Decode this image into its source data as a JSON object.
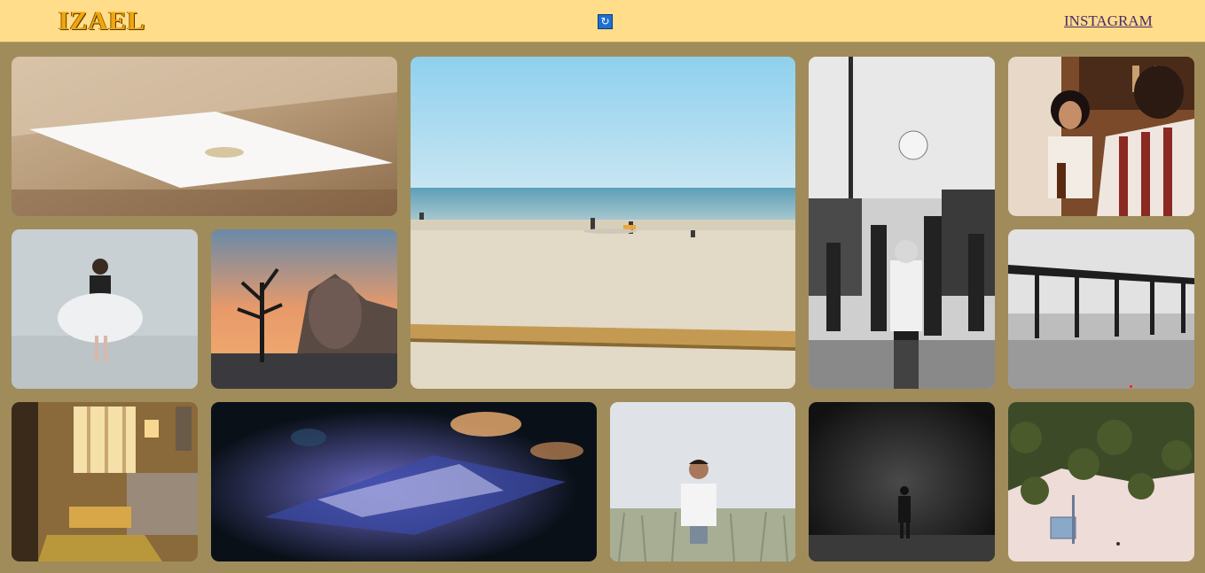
{
  "header": {
    "logo": "IZAEL",
    "center_icon": "photo-app-icon",
    "instagram_link": "INSTAGRAM"
  },
  "colors": {
    "header_bg": "#ffdd8a",
    "page_bg": "#a08c5b",
    "logo": "#f2a50c",
    "link": "#4b2a6a"
  },
  "gallery": {
    "photos": [
      "letter-on-stone-photo",
      "beach-surfers-photo",
      "fairground-bw-photo",
      "cafe-couple-photo",
      "ballerina-photo",
      "desert-sunset-photo",
      "pier-bw-photo",
      "vintage-living-room-photo",
      "blurred-night-figure-photo",
      "man-in-field-photo",
      "dark-forest-walker-photo",
      "aerial-palm-beach-photo"
    ]
  }
}
